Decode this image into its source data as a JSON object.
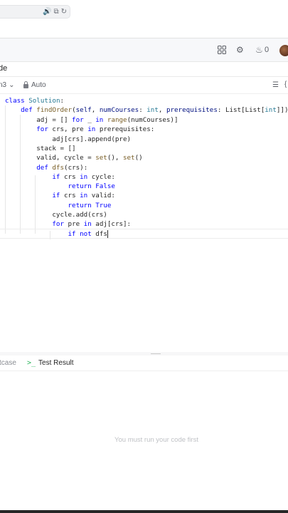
{
  "browser": {
    "icons": [
      "speaker-icon",
      "translate-icon",
      "reload-icon"
    ]
  },
  "nav": {
    "fire_count": "0"
  },
  "editor": {
    "panel_title": "de",
    "language": "n3",
    "mode_label": "Auto",
    "code_lines": [
      "class Solution:",
      "    def findOrder(self, numCourses: int, prerequisites: List[List[int]]) -> L",
      "        adj = [] for _ in range(numCourses)]",
      "        for crs, pre in prerequisites:",
      "            adj[crs].append(pre)",
      "        stack = []",
      "        valid, cycle = set(), set()",
      "        def dfs(crs):",
      "            if crs in cycle:",
      "                return False",
      "            if crs in valid:",
      "                return True",
      "            cycle.add(crs)",
      "            for pre in adj[crs]:",
      "                if not dfs"
    ]
  },
  "bottom": {
    "tab_testcase": "stcase",
    "tab_result": "Test Result",
    "empty_message": "You must run your code first"
  },
  "colors": {
    "keyword": "#0000ff",
    "class_name": "#257893",
    "function": "#795e26",
    "accent_green": "#2db55d"
  }
}
